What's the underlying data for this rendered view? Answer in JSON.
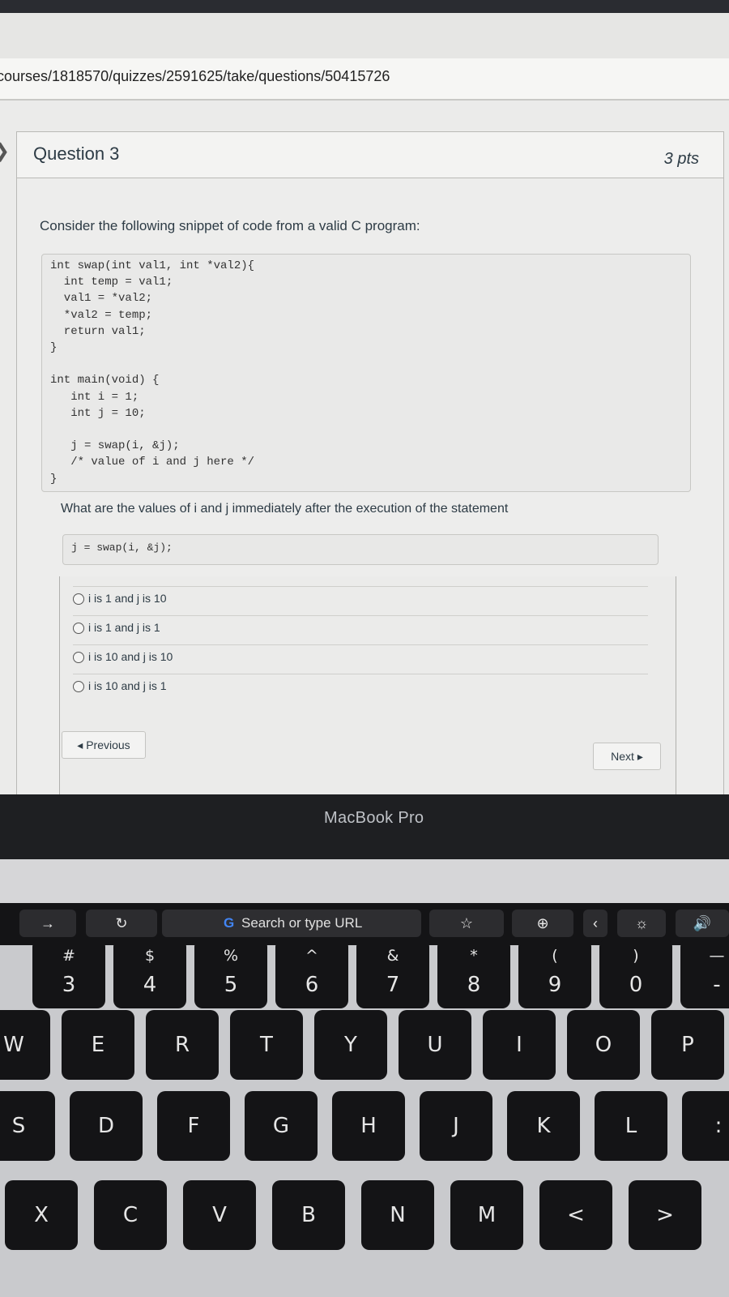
{
  "browser": {
    "url": "courses/1818570/quizzes/2591625/take/questions/50415726"
  },
  "question": {
    "title": "Question 3",
    "points": "3 pts",
    "prompt": "Consider the following snippet of code from a valid C program:",
    "code_lines": [
      "int swap(int val1, int *val2){",
      "  int temp = val1;",
      "  val1 = *val2;",
      "  *val2 = temp;",
      "  return val1;",
      "}",
      "",
      "int main(void) {",
      "   int i = 1;",
      "   int j = 10;",
      "",
      "   j = swap(i, &j);",
      "   /* value of i and j here */",
      "}"
    ],
    "question_text": "What are the values of i and j immediately after the execution of the statement",
    "statement": "j = swap(i, &j);",
    "answers": [
      "i is 1 and j is 10",
      "i is 1 and j is 1",
      "i is 10 and j is 10",
      "i is 10 and j is 1"
    ]
  },
  "nav": {
    "previous_label": "◂ Previous",
    "next_label": "Next ▸"
  },
  "laptop": {
    "brand_label": "MacBook Pro"
  },
  "touchbar": {
    "search_placeholder": "Search or type URL",
    "g_logo": "G"
  },
  "keyboard": {
    "number_row": [
      {
        "sym": "#",
        "main": "3"
      },
      {
        "sym": "$",
        "main": "4"
      },
      {
        "sym": "%",
        "main": "5"
      },
      {
        "sym": "^",
        "main": "6"
      },
      {
        "sym": "&",
        "main": "7"
      },
      {
        "sym": "*",
        "main": "8"
      },
      {
        "sym": "(",
        "main": "9"
      },
      {
        "sym": ")",
        "main": "0"
      },
      {
        "sym": "—",
        "main": "-"
      }
    ],
    "row_qwerty": [
      "W",
      "E",
      "R",
      "T",
      "Y",
      "U",
      "I",
      "O",
      "P"
    ],
    "row_home": [
      "S",
      "D",
      "F",
      "G",
      "H",
      "J",
      "K",
      "L",
      ":"
    ],
    "row_bottom": [
      "X",
      "C",
      "V",
      "B",
      "N",
      "M",
      "<",
      ">"
    ]
  }
}
